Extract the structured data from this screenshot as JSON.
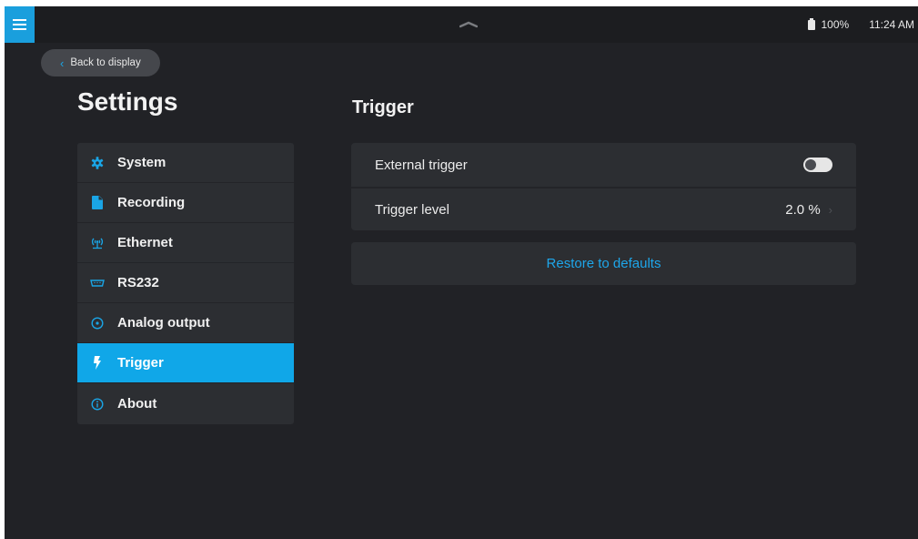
{
  "status": {
    "battery": "100%",
    "time": "11:24 AM"
  },
  "back_button": {
    "label": "Back to display"
  },
  "settings_title": "Settings",
  "sidebar": {
    "items": [
      {
        "label": "System",
        "icon": "gear-icon",
        "active": false
      },
      {
        "label": "Recording",
        "icon": "file-icon",
        "active": false
      },
      {
        "label": "Ethernet",
        "icon": "antenna-icon",
        "active": false
      },
      {
        "label": "RS232",
        "icon": "serial-port-icon",
        "active": false
      },
      {
        "label": "Analog output",
        "icon": "radio-circle-icon",
        "active": false
      },
      {
        "label": "Trigger",
        "icon": "lightning-icon",
        "active": true
      },
      {
        "label": "About",
        "icon": "info-icon",
        "active": false
      }
    ]
  },
  "main": {
    "title": "Trigger",
    "options": [
      {
        "label": "External trigger",
        "type": "toggle",
        "value": false
      },
      {
        "label": "Trigger level",
        "type": "value",
        "value": "2.0 %"
      }
    ],
    "restore_label": "Restore to defaults"
  },
  "colors": {
    "accent": "#10a7e8",
    "background": "#212226",
    "card": "#2c2e32",
    "link": "#1ea6ea"
  }
}
